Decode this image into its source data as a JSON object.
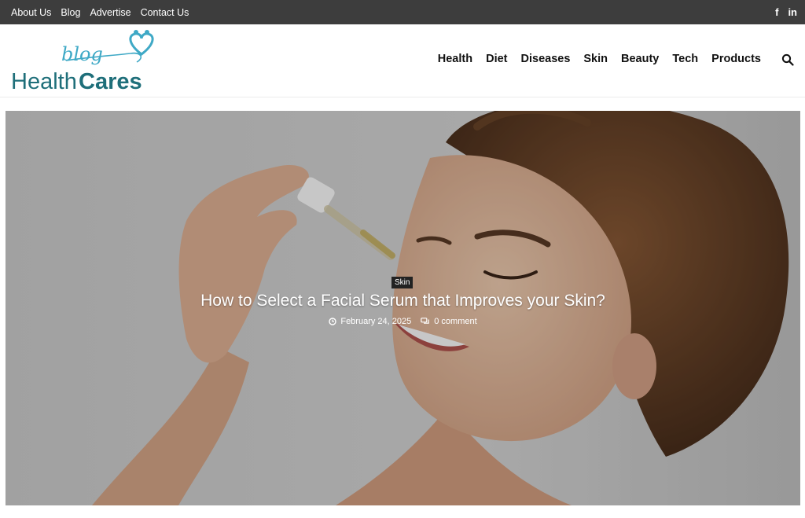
{
  "topbar": {
    "links": [
      "About Us",
      "Blog",
      "Advertise",
      "Contact Us"
    ],
    "social": [
      {
        "icon": "facebook-icon",
        "glyph": "f"
      },
      {
        "icon": "linkedin-icon",
        "glyph": "in"
      }
    ]
  },
  "logo": {
    "script_text": "blog",
    "word1": "Health",
    "word2": "Cares",
    "colors": {
      "teal": "#1f6f7a",
      "blue": "#3fa9c6"
    }
  },
  "nav": {
    "items": [
      "Health",
      "Diet",
      "Diseases",
      "Skin",
      "Beauty",
      "Tech",
      "Products"
    ],
    "search_icon": "search-icon"
  },
  "hero": {
    "category": "Skin",
    "title": "How to Select a Facial Serum that Improves your Skin?",
    "date": "February 24, 2025",
    "comments": "0 comment"
  }
}
